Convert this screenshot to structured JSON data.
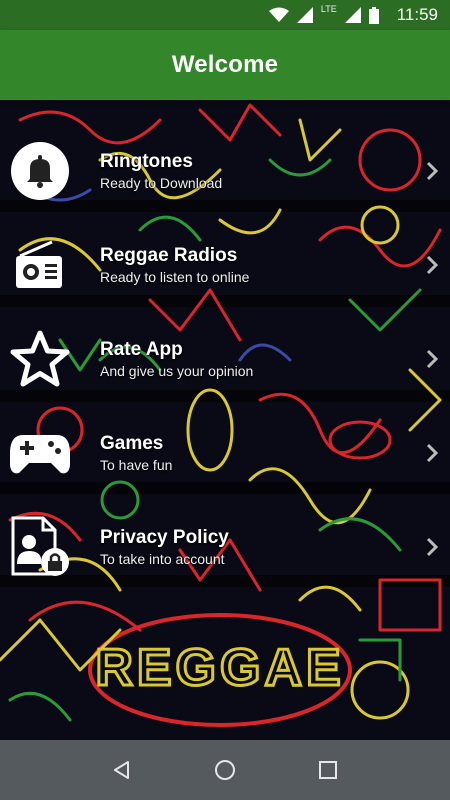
{
  "status_bar": {
    "time": "11:59",
    "network": "LTE",
    "icons": [
      "wifi-icon",
      "signal-icon",
      "lte-signal-icon",
      "battery-icon"
    ]
  },
  "app_bar": {
    "title": "Welcome"
  },
  "colors": {
    "status_bar": "#2b6e23",
    "app_bar": "#33862a",
    "nav_bar": "#555a5e",
    "art_red": "#d8262b",
    "art_yellow": "#d9c832",
    "art_green": "#2d9a3a"
  },
  "menu": {
    "items": [
      {
        "title": "Ringtones",
        "subtitle": "Ready to Download",
        "icon": "bell-icon"
      },
      {
        "title": "Reggae Radios",
        "subtitle": "Ready to listen to online",
        "icon": "radio-icon"
      },
      {
        "title": "Rate App",
        "subtitle": "And give us your opinion",
        "icon": "star-icon"
      },
      {
        "title": "Games",
        "subtitle": "To have fun",
        "icon": "gamepad-icon"
      },
      {
        "title": "Privacy Policy",
        "subtitle": "To take into account",
        "icon": "privacy-document-icon"
      }
    ]
  },
  "background_art": {
    "text": "REGGAE"
  },
  "nav_bar": {
    "buttons": [
      "back-icon",
      "home-icon",
      "recents-icon"
    ]
  }
}
